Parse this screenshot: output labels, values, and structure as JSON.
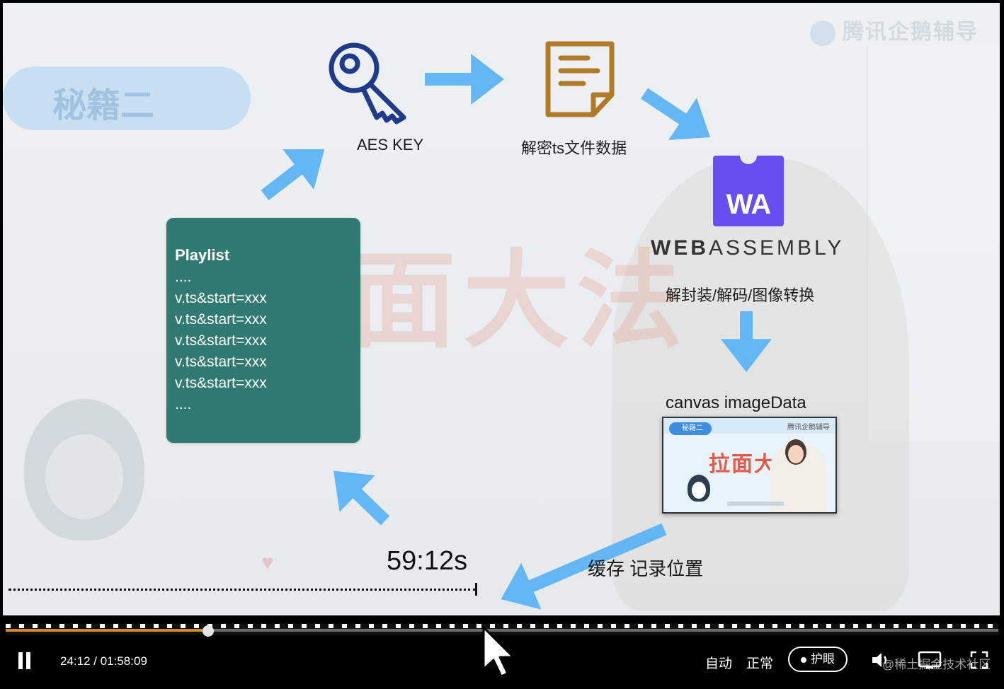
{
  "diagram": {
    "aes_label": "AES KEY",
    "decrypt_label": "解密ts文件数据",
    "wasm_label": "解封装/解码/图像转换",
    "canvas_label": "canvas imageData",
    "cache_label": "缓存 记录位置",
    "time_marker": "59:12s",
    "wasm_word_bold": "WEB",
    "wasm_word_rest": "ASSEMBLY",
    "wasm_logo_text": "WA",
    "playlist": {
      "title": "Playlist",
      "lines": [
        "....",
        "v.ts&start=xxx",
        "v.ts&start=xxx",
        "v.ts&start=xxx",
        "v.ts&start=xxx",
        "v.ts&start=xxx",
        "...."
      ]
    },
    "arrow_color": "#5eb4f5"
  },
  "background": {
    "logo_text": "腾讯企鹅辅导",
    "title_text": "面大法",
    "pill_text": "秘籍二"
  },
  "thumbnail": {
    "title": "拉面大法",
    "pill": "秘籍二",
    "logo": "腾讯企鹅辅导"
  },
  "controls": {
    "current_time": "24:12",
    "duration": "01:58:09",
    "time_separator": " / ",
    "progress_fraction": 0.204,
    "auto_label": "自动",
    "speed_label": "正常",
    "eye_label": "护眼",
    "watermark": "@稀土掘金技术社区",
    "progress_color": "#d48a2a"
  }
}
